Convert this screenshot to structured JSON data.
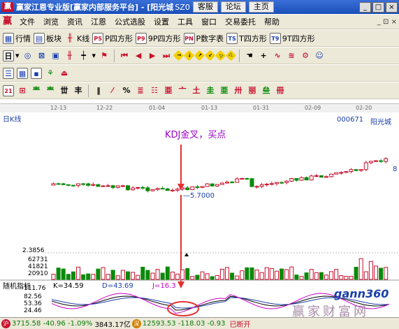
{
  "title": "赢家江恩专业版[赢家内部服务平台] - [阳光城",
  "title_suffix": "SZ0",
  "title_links": [
    "客服",
    "论坛",
    "主页"
  ],
  "window_buttons": [
    "_",
    "□",
    "×"
  ],
  "menu": [
    "文件",
    "浏览",
    "资讯",
    "江恩",
    "公式选股",
    "设置",
    "工具",
    "窗口",
    "交易委托",
    "帮助"
  ],
  "menu_right": "_ ⊡ ×",
  "toolbar1": [
    {
      "icon": "grid-icon",
      "label": "行情"
    },
    {
      "icon": "block-icon",
      "label": "板块"
    },
    {
      "icon": "kline-icon",
      "label": "K线"
    },
    {
      "icon": "ps-icon",
      "glyph": "PS",
      "label": "P四方形"
    },
    {
      "icon": "p9-icon",
      "glyph": "P9",
      "label": "9P四方形"
    },
    {
      "icon": "pn-icon",
      "glyph": "PN",
      "label": "P数字表"
    },
    {
      "icon": "ts-icon",
      "glyph": "TS",
      "label": "T四方形"
    },
    {
      "icon": "t9-icon",
      "glyph": "T9",
      "label": "9T四方形"
    }
  ],
  "toolbar2_first": "日",
  "toolbar3_first": "21",
  "dates": [
    "12-13",
    "12-22",
    "01-04",
    "01-13",
    "01-31",
    "02-09",
    "02-20"
  ],
  "chart_period": "日K线",
  "stock_code": "000671",
  "stock_name": "阳光城",
  "annotation": "KDJ金叉，买点",
  "price_label": "5.7000",
  "right_price": "8",
  "vol_max": "2.3856",
  "vol_labels": [
    "62731",
    "41821",
    "20910"
  ],
  "kdj_name": "随机指标",
  "kdj_k": "K=34.59",
  "kdj_d": "D=43.69",
  "kdj_j": "J=16.3",
  "kdj_levels": [
    "111.76",
    "82.56",
    "53.36",
    "24.46"
  ],
  "status": {
    "sh_index": "3715.58",
    "sh_change": "-40.96",
    "sh_pct": "-1.09%",
    "sh_amount": "3843.17亿",
    "sz_index": "12593.53",
    "sz_change": "-118.03",
    "sz_pct": "-0.93",
    "tail": "已断开"
  },
  "watermark": "赢家财富网",
  "watermark_logo": "gann360",
  "colors": {
    "up": "#c8102e",
    "down": "#0a8a0a",
    "k": "#000000",
    "d": "#1a3fa8",
    "j": "#c800c8",
    "arrow": "#e83030"
  }
}
